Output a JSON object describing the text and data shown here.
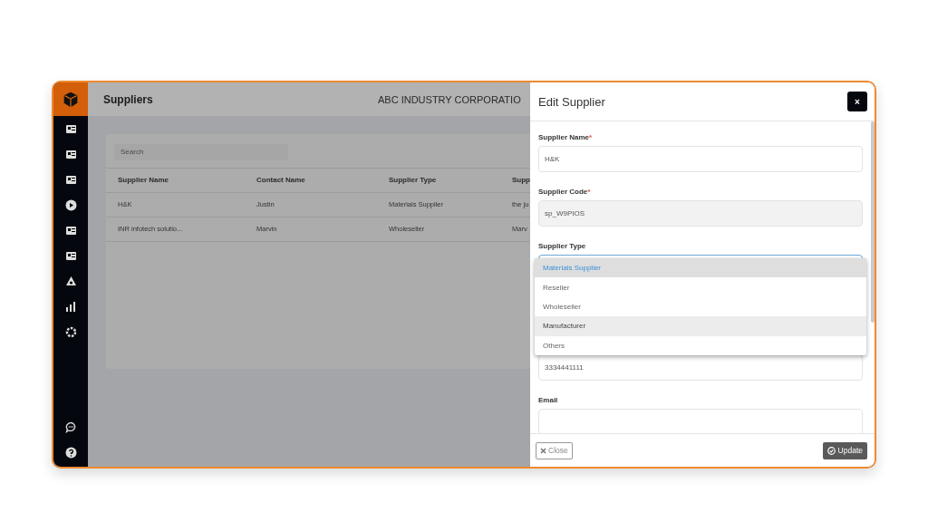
{
  "header": {
    "title": "Suppliers",
    "company": "ABC INDUSTRY CORPORATIO"
  },
  "table": {
    "search": {
      "placeholder": "Search"
    },
    "columns": [
      "Supplier Name",
      "Contact Name",
      "Supplier Type",
      "Supp"
    ],
    "rows": [
      {
        "cells": [
          "H&K",
          "Justin",
          "Materials Supplier",
          "the ju"
        ]
      },
      {
        "cells": [
          "INR infotech solutio...",
          "Marvin",
          "Wholeseller",
          "Marv"
        ]
      }
    ]
  },
  "modal": {
    "title": "Edit Supplier",
    "close": "×",
    "fields": [
      {
        "kind": "text",
        "label": "Supplier Name",
        "required_mark": "*",
        "value": "H&K"
      },
      {
        "kind": "readonly",
        "label": "Supplier Code",
        "required_mark": "*",
        "value": "sp_W9PIOS"
      },
      {
        "kind": "select",
        "label": "Supplier Type",
        "expanded": true,
        "options": [
          {
            "label": "Materials Supplier",
            "selected": true,
            "hovered": false
          },
          {
            "label": "Reseller",
            "selected": false,
            "hovered": false
          },
          {
            "label": "Wholeseller",
            "selected": false,
            "hovered": false
          },
          {
            "label": "Manufacturer",
            "selected": false,
            "hovered": true
          },
          {
            "label": "Others",
            "selected": false,
            "hovered": false
          }
        ]
      },
      {
        "kind": "hidden-label",
        "value": "3334441111"
      },
      {
        "kind": "text",
        "label": "Email"
      }
    ],
    "buttons": [
      {
        "kind": "close",
        "label": "Close"
      },
      {
        "kind": "update",
        "label": "Update"
      }
    ]
  }
}
